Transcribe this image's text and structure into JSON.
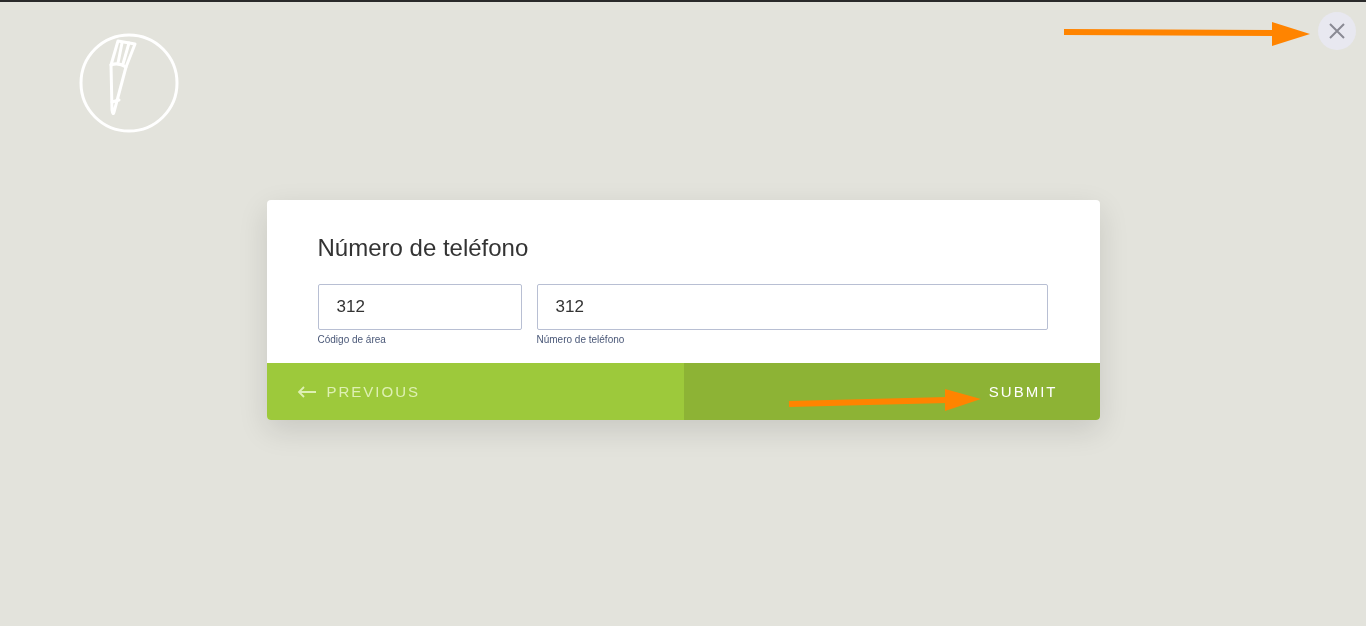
{
  "form": {
    "title": "Número de teléfono",
    "fields": [
      {
        "value": "312",
        "label": "Código de área"
      },
      {
        "value": "312",
        "label": "Número de teléfono"
      }
    ],
    "previous_button": "PREVIOUS",
    "submit_button": "SUBMIT"
  }
}
